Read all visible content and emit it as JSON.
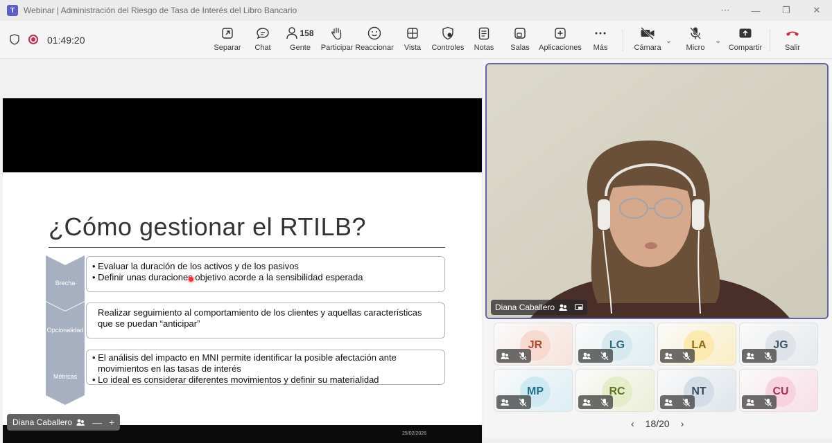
{
  "window": {
    "title": "Webinar | Administración del Riesgo de Tasa de Interés del Libro Bancario",
    "controls": [
      "⋯",
      "—",
      "❐",
      "✕"
    ]
  },
  "toolbar": {
    "timer": "01:49:20",
    "people_count": "158",
    "buttons": {
      "separar": "Separar",
      "chat": "Chat",
      "gente": "Gente",
      "participar": "Participar",
      "reaccionar": "Reaccionar",
      "vista": "Vista",
      "controles": "Controles",
      "notas": "Notas",
      "salas": "Salas",
      "aplicaciones": "Aplicaciones",
      "mas": "Más",
      "camara": "Cámara",
      "micro": "Micro",
      "compartir": "Compartir",
      "salir": "Salir"
    },
    "colors": {
      "leave": "#c4314b",
      "record": "#c4314b"
    }
  },
  "slide": {
    "title": "¿Cómo gestionar el RTILB?",
    "date": "25/02/2026",
    "sections": [
      {
        "label": "Brecha",
        "bullets": [
          "Evaluar la duración de los activos y de los pasivos",
          "Definir unas duraciones objetivo acorde a la sensibilidad esperada"
        ]
      },
      {
        "label": "Opcionalidad",
        "bullets": [
          "Realizar seguimiento al comportamiento de los clientes y aquellas características que se puedan “anticipar”"
        ]
      },
      {
        "label": "Métricas",
        "bullets": [
          "El análisis del impacto en MNI permite identificar la posible afectación ante movimientos en las tasas de interés",
          "Lo ideal es considerar diferentes movimientos y definir su materialidad"
        ]
      }
    ],
    "colors": {
      "chevron": "#a7b0c0",
      "text": "#333333"
    }
  },
  "presenter": {
    "name": "Diana Caballero",
    "pill_controls": [
      "—",
      "+"
    ]
  },
  "speaker": {
    "name": "Diana Caballero"
  },
  "participants": [
    {
      "initials": "JR",
      "bg": "#f7d9cf",
      "fg": "#b4462d"
    },
    {
      "initials": "LG",
      "bg": "#d5e9ef",
      "fg": "#2e6a80"
    },
    {
      "initials": "LA",
      "bg": "#fbe9b0",
      "fg": "#8a6a12"
    },
    {
      "initials": "JG",
      "bg": "#dde3e8",
      "fg": "#3d5566"
    },
    {
      "initials": "MP",
      "bg": "#cfe9f3",
      "fg": "#1f6f8b"
    },
    {
      "initials": "RC",
      "bg": "#e5ecc9",
      "fg": "#5f7121"
    },
    {
      "initials": "NT",
      "bg": "#d4dde6",
      "fg": "#344c5e"
    },
    {
      "initials": "CU",
      "bg": "#f7d3df",
      "fg": "#b02c5a"
    }
  ],
  "pager": {
    "text": "18/20"
  }
}
